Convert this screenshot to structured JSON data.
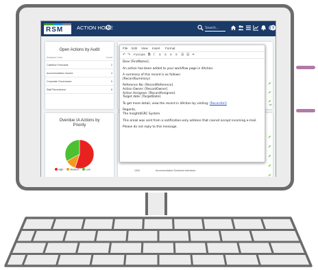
{
  "header": {
    "logo_text": "RSM",
    "title": "ACTION HOME",
    "search_placeholder": "Search...",
    "icons": [
      "refresh-icon",
      "search-icon",
      "home-icon",
      "users-icon",
      "list-icon",
      "chart-icon",
      "bell-icon",
      "settings-icon",
      "help-icon"
    ],
    "background": "#1a3a68"
  },
  "open_actions": {
    "title": "Open Actions by Audit",
    "columns": [
      "Analysis Code",
      "Count"
    ],
    "rows": [
      {
        "name": "Cashflow Forecasts",
        "count": "2"
      },
      {
        "name": "Accommodation Income",
        "count": "4"
      },
      {
        "name": "Corporate Governance",
        "count": "5"
      },
      {
        "name": "Staff Recruitment",
        "count": "8"
      }
    ]
  },
  "overdue": {
    "title_line1": "Overdue IA Actions by",
    "title_line2": "Priority",
    "legend": [
      {
        "label": "High",
        "color": "#e8231f"
      },
      {
        "label": "Medium",
        "color": "#f39a1e"
      },
      {
        "label": "Low",
        "color": "#4cc02f"
      }
    ],
    "pie": [
      {
        "label": "High",
        "fraction": 0.55,
        "color": "#e8231f"
      },
      {
        "label": "Medium",
        "fraction": 0.12,
        "color": "#f39a1e"
      },
      {
        "label": "Low",
        "fraction": 0.33,
        "color": "#4cc02f"
      }
    ]
  },
  "bottom_row": {
    "id": "1393",
    "text": "Accommodation Solutions Interfaces"
  },
  "editor": {
    "menu": [
      "File",
      "Edit",
      "View",
      "Insert",
      "Format"
    ],
    "toolbar_format": "Formats",
    "body": {
      "greeting": "Dear [FirstName],",
      "line1": "An action has been added to your workflow page in 4Action.",
      "summary_intro": "A summary of this record is as follows:",
      "summary_field": "[RecordSummary]",
      "ref": "Reference No: [RecordReference].",
      "owner": "Action Owner: [RecordOwner].",
      "assignee": "Action Assignee: [RecordAssignee].",
      "target": "Target date: [TargetDate].",
      "detail_text": "To get more detail, view the record in 4Action by visiting:",
      "detail_link": "[RecordUrl]",
      "regards": "Regards,",
      "system": "The Insight4GRC System",
      "notice": "This email was sent from a notification-only address that cannot accept incoming e-mail.",
      "noreply": "Please do not reply to this message."
    }
  },
  "accent_colors": {
    "dash": "#b07aa6",
    "edit_icon": "#4cc02f"
  }
}
